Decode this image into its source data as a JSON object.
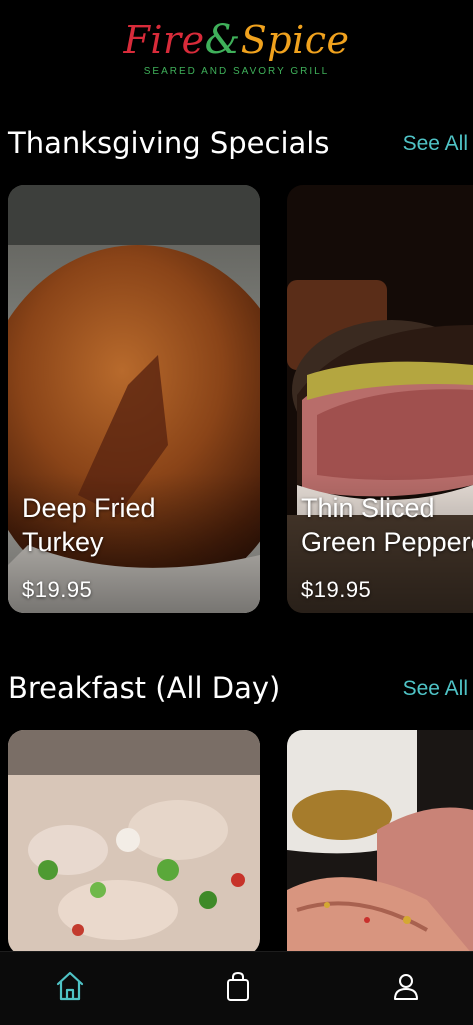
{
  "header": {
    "logo_word1": "Fire",
    "logo_amp": "&",
    "logo_word2": "Spice",
    "tagline": "SEARED AND SAVORY GRILL"
  },
  "sections": [
    {
      "title": "Thanksgiving Specials",
      "see_all": "See All",
      "cards": [
        {
          "title_line1": "Deep Fried",
          "title_line2": "Turkey",
          "price": "$19.95"
        },
        {
          "title_line1": "Thin Sliced",
          "title_line2": "Green Peppercorn",
          "price": "$19.95"
        }
      ]
    },
    {
      "title": "Breakfast (All Day)",
      "see_all": "See All",
      "cards": []
    }
  ],
  "nav": {
    "items": [
      {
        "icon": "home-icon",
        "active": true
      },
      {
        "icon": "shopping-bag-icon",
        "active": false
      },
      {
        "icon": "user-icon",
        "active": false
      }
    ]
  },
  "colors": {
    "accent": "#4fc3c6",
    "logo_red": "#d82b3a",
    "logo_green": "#3fb05a",
    "logo_orange": "#f0a21e"
  }
}
